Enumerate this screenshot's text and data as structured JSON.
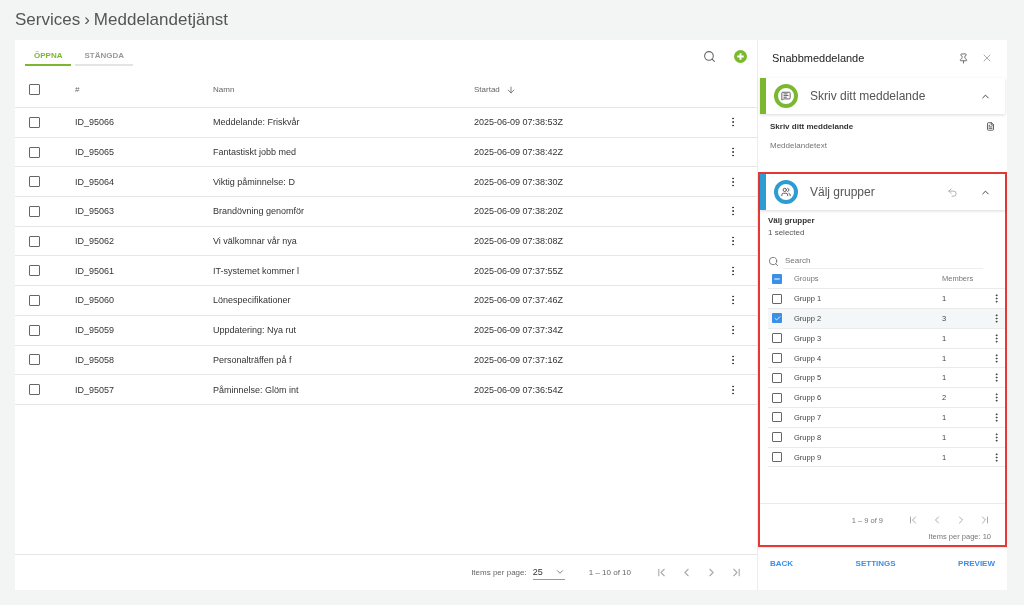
{
  "breadcrumb": {
    "root": "Services",
    "separator": "›",
    "current": "Meddelandetjänst"
  },
  "tabs": [
    {
      "label": "ÖPPNA",
      "selected": true
    },
    {
      "label": "STÄNGDA",
      "selected": false
    }
  ],
  "table": {
    "all_checked": false,
    "columns": [
      {
        "label": "#"
      },
      {
        "label": "Namn"
      },
      {
        "label": "Startad",
        "sorted_descending": true
      }
    ],
    "rows": [
      {
        "id": "ID_95066",
        "name": "Meddelande: Friskvår",
        "started": "2025-06-09 07:38:53Z",
        "checked": false
      },
      {
        "id": "ID_95065",
        "name": "Fantastiskt jobb med",
        "started": "2025-06-09 07:38:42Z",
        "checked": false
      },
      {
        "id": "ID_95064",
        "name": "Viktig påminnelse: D",
        "started": "2025-06-09 07:38:30Z",
        "checked": false
      },
      {
        "id": "ID_95063",
        "name": "Brandövning genomför",
        "started": "2025-06-09 07:38:20Z",
        "checked": false
      },
      {
        "id": "ID_95062",
        "name": "Vi välkomnar vår nya",
        "started": "2025-06-09 07:38:08Z",
        "checked": false
      },
      {
        "id": "ID_95061",
        "name": "IT-systemet kommer l",
        "started": "2025-06-09 07:37:55Z",
        "checked": false
      },
      {
        "id": "ID_95060",
        "name": "Lönespecifikationer",
        "started": "2025-06-09 07:37:46Z",
        "checked": false
      },
      {
        "id": "ID_95059",
        "name": "Uppdatering: Nya rut",
        "started": "2025-06-09 07:37:34Z",
        "checked": false
      },
      {
        "id": "ID_95058",
        "name": "Personalträffen på f",
        "started": "2025-06-09 07:37:16Z",
        "checked": false
      },
      {
        "id": "ID_95057",
        "name": "Påminnelse: Glöm int",
        "started": "2025-06-09 07:36:54Z",
        "checked": false
      }
    ]
  },
  "pagination": {
    "items_per_page_label": "Items per page:",
    "items_per_page": "25",
    "range": "1 – 10 of 10"
  },
  "panel": {
    "title": "Snabbmeddelande",
    "sections": [
      {
        "kind": "message",
        "title": "Skriv ditt meddelande",
        "expanded": true,
        "highlighted": false,
        "color": "#7cb82f",
        "field_label": "Skriv ditt meddelande",
        "placeholder": "Meddelandetext"
      },
      {
        "kind": "groups",
        "title": "Välj grupper",
        "expanded": true,
        "highlighted": true,
        "color": "#2d9cd3",
        "field_label": "Välj grupper",
        "selection": "1 selected",
        "search_placeholder": "Search",
        "columns": [
          "Groups",
          "Members"
        ],
        "all_indeterminate": true,
        "rows": [
          {
            "name": "Grupp 1",
            "members": "1",
            "checked": false
          },
          {
            "name": "Grupp 2",
            "members": "3",
            "checked": true
          },
          {
            "name": "Grupp 3",
            "members": "1",
            "checked": false
          },
          {
            "name": "Grupp 4",
            "members": "1",
            "checked": false
          },
          {
            "name": "Grupp 5",
            "members": "1",
            "checked": false
          },
          {
            "name": "Grupp 6",
            "members": "2",
            "checked": false
          },
          {
            "name": "Grupp 7",
            "members": "1",
            "checked": false
          },
          {
            "name": "Grupp 8",
            "members": "1",
            "checked": false
          },
          {
            "name": "Grupp 9",
            "members": "1",
            "checked": false
          }
        ],
        "range": "1 – 9 of 9",
        "items_per_page": "Items per page: 10"
      }
    ],
    "actions": [
      "BACK",
      "SETTINGS",
      "PREVIEW"
    ]
  }
}
